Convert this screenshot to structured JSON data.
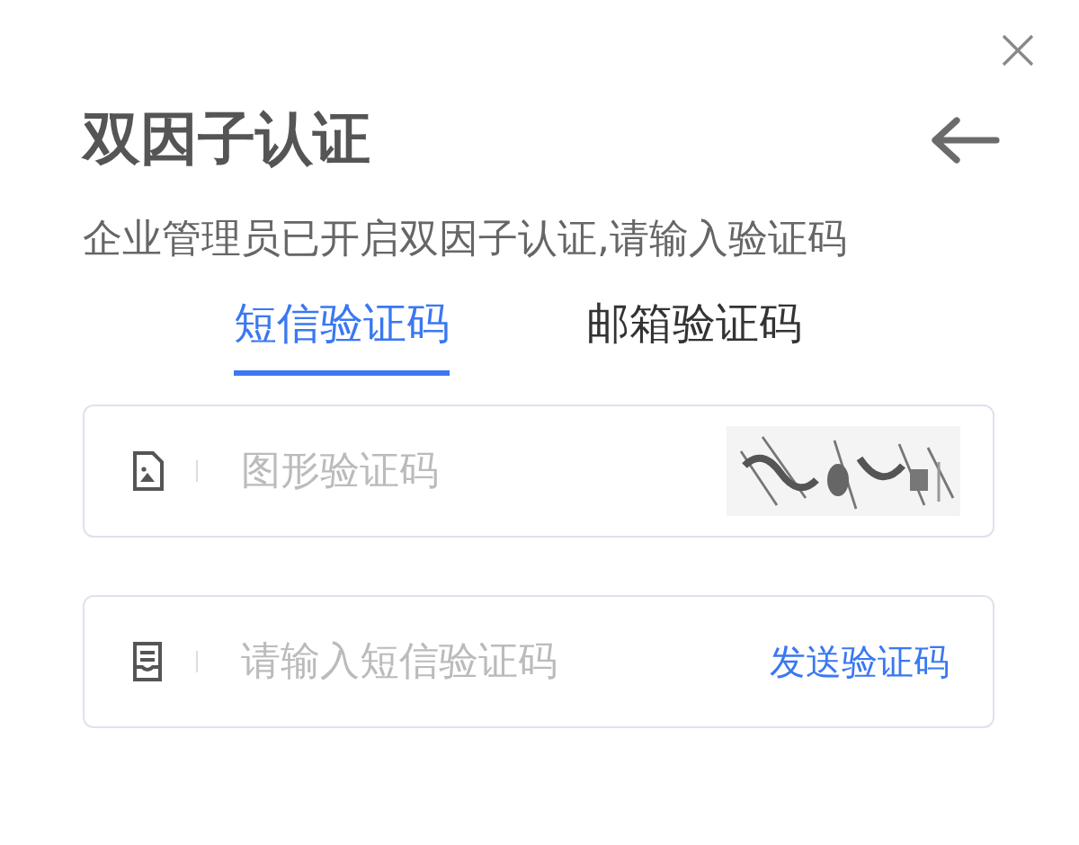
{
  "title": "双因子认证",
  "subtitle": "企业管理员已开启双因子认证,请输入验证码",
  "tabs": [
    {
      "label": "短信验证码",
      "selected": true
    },
    {
      "label": "邮箱验证码",
      "selected": false
    }
  ],
  "fields": [
    {
      "kind": "captcha",
      "placeholder": "图形验证码"
    },
    {
      "kind": "sms",
      "placeholder": "请输入短信验证码",
      "action": "发送验证码"
    }
  ]
}
